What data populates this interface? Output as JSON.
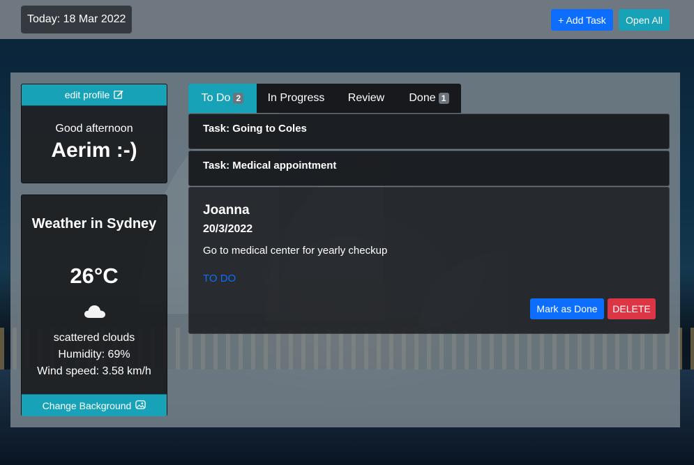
{
  "header": {
    "today_label": "Today: 18 Mar 2022",
    "add_task_label": "+ Add Task",
    "open_all_label": "Open All"
  },
  "profile": {
    "edit_label": "edit profile",
    "edit_icon": "pencil-square-icon",
    "greeting": "Good afternoon",
    "name": "Aerim :-)"
  },
  "weather": {
    "title": "Weather in Sydney",
    "temperature": "26°C",
    "icon": "cloud-icon",
    "condition": "scattered clouds",
    "humidity": "Humidity: 69%",
    "wind": "Wind speed: 3.58 km/h",
    "change_bg_label": "Change Background",
    "change_bg_icon": "image-icon"
  },
  "tabs": [
    {
      "label": "To Do",
      "badge": "2",
      "active": true
    },
    {
      "label": "In Progress",
      "badge": "",
      "active": false
    },
    {
      "label": "Review",
      "badge": "",
      "active": false
    },
    {
      "label": "Done",
      "badge": "1",
      "active": false
    }
  ],
  "tasks": [
    {
      "title": "Task: Going to Coles"
    },
    {
      "title": "Task: Medical appointment"
    }
  ],
  "task_detail": {
    "name": "Joanna",
    "date": "20/3/2022",
    "description": "Go to medical center for yearly checkup",
    "status": "TO DO",
    "mark_done_label": "Mark as Done",
    "delete_label": "DELETE"
  },
  "colors": {
    "primary": "#0d6efd",
    "info": "#17a2b8",
    "danger": "#dc3545",
    "dark": "#343a40"
  }
}
